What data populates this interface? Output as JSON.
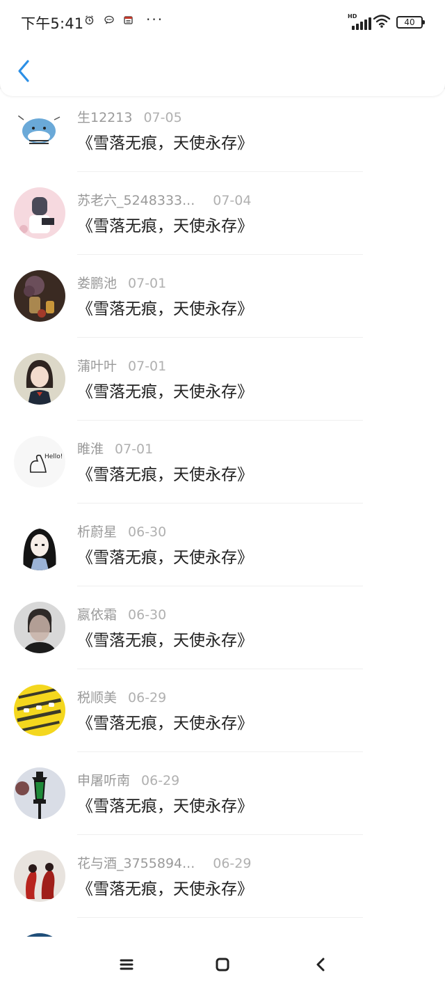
{
  "status_bar": {
    "time": "下午5:41",
    "icons": [
      "alarm-icon",
      "chat-icon",
      "calendar-icon"
    ],
    "overflow": "···",
    "network": "HD",
    "battery": "40"
  },
  "header": {
    "back_icon": "chevron-left-icon"
  },
  "comments": [
    {
      "name": "生12213",
      "date": "07-05",
      "title": "《雪落无痕，天使永存》"
    },
    {
      "name": "苏老六_5248333...",
      "date": "07-04",
      "title": "《雪落无痕，天使永存》"
    },
    {
      "name": "娄鹏池",
      "date": "07-01",
      "title": "《雪落无痕，天使永存》"
    },
    {
      "name": "蒲叶叶",
      "date": "07-01",
      "title": "《雪落无痕，天使永存》"
    },
    {
      "name": "睢淮",
      "date": "07-01",
      "title": "《雪落无痕，天使永存》"
    },
    {
      "name": "析蔚星",
      "date": "06-30",
      "title": "《雪落无痕，天使永存》"
    },
    {
      "name": "嬴依霜",
      "date": "06-30",
      "title": "《雪落无痕，天使永存》"
    },
    {
      "name": "税顺美",
      "date": "06-29",
      "title": "《雪落无痕，天使永存》"
    },
    {
      "name": "申屠听南",
      "date": "06-29",
      "title": "《雪落无痕，天使永存》"
    },
    {
      "name": "花与酒_3755894...",
      "date": "06-29",
      "title": "《雪落无痕，天使永存》"
    }
  ],
  "nav_bar": {
    "menu_icon": "menu-icon",
    "home_icon": "home-icon",
    "back_icon": "back-icon"
  },
  "colors": {
    "accent": "#2b8fe6",
    "name_text": "#9a9a9a",
    "title_text": "#222222"
  }
}
